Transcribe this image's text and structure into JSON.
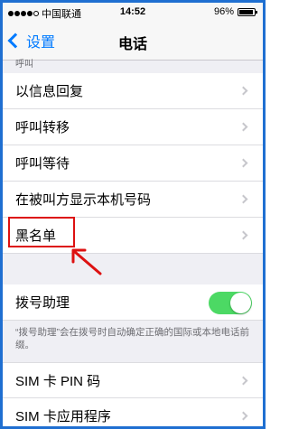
{
  "status_bar": {
    "carrier": "中国联通",
    "time": "14:52",
    "battery": "96%",
    "battery_level": 0.96
  },
  "nav": {
    "back_label": "设置",
    "title": "电话"
  },
  "sections": {
    "call_header": "呼叫",
    "call_rows": [
      {
        "label": "以信息回复"
      },
      {
        "label": "呼叫转移"
      },
      {
        "label": "呼叫等待"
      },
      {
        "label": "在被叫方显示本机号码"
      },
      {
        "label": "黑名单"
      }
    ],
    "dial_assist": {
      "label": "拨号助理",
      "enabled": true,
      "footnote": "“拨号助理”会在拨号时自动确定正确的国际或本地电话前缀。"
    },
    "sim_rows": [
      {
        "label": "SIM 卡 PIN 码"
      },
      {
        "label": "SIM 卡应用程序"
      }
    ]
  },
  "colors": {
    "accent": "#007aff",
    "toggle_on": "#4cd964",
    "annotation": "#dd1111",
    "frame": "#1f6fd1"
  }
}
